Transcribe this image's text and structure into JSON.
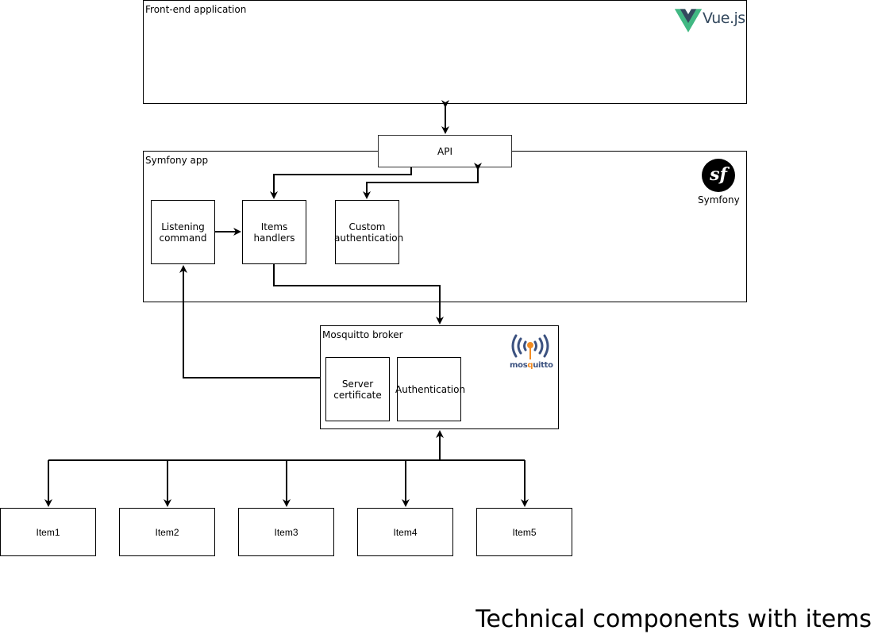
{
  "containers": {
    "frontend": {
      "label": "Front-end application",
      "logo": {
        "name": "vue-logo",
        "text": "Vue.js",
        "colors": {
          "outer": "#41b883",
          "inner": "#34495e"
        }
      }
    },
    "symfony": {
      "label": "Symfony app",
      "logo": {
        "name": "symfony-logo",
        "text": "Symfony",
        "glyph": "sf"
      }
    },
    "mosquitto": {
      "label": "Mosquitto broker",
      "logo": {
        "name": "mosquitto-logo",
        "text_pre": "mos",
        "text_accent": "q",
        "text_post": "uitto",
        "colors": {
          "waves": "#3c5280",
          "accent": "#f28c22"
        }
      }
    }
  },
  "nodes": {
    "api": "API",
    "listening_command": "Listening\ncommand",
    "items_handlers": "Items\nhandlers",
    "custom_authentication": "Custom\nauthentication",
    "server_certificate": "Server\ncertificate",
    "authentication": "Authentication"
  },
  "items": [
    "Item1",
    "Item2",
    "Item3",
    "Item4",
    "Item5"
  ],
  "footer": {
    "title": "Technical components with items"
  }
}
